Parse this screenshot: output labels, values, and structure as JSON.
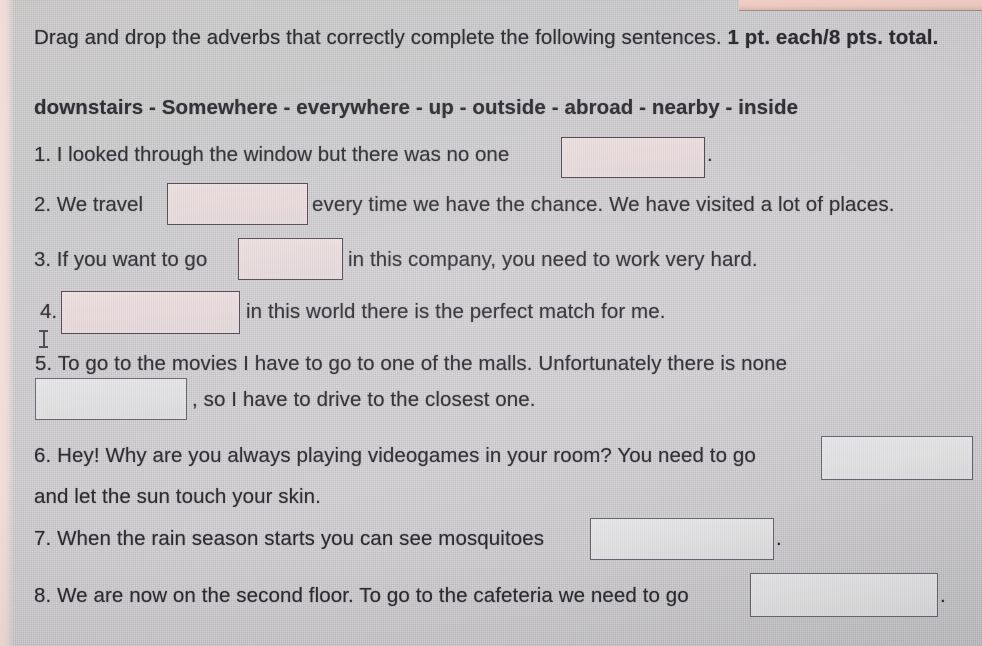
{
  "worksheet": {
    "instructions": {
      "normal_text": "Drag and drop the adverbs that correctly complete the following sentences. ",
      "bold_text": "1 pt. each/8 pts. total.",
      "full_text": "Drag and drop the adverbs that correctly complete the following sentences. 1 pt. each/8 pts. total."
    },
    "word_bank": {
      "text": "downstairs - Somewhere - everywhere - up - outside - abroad - nearby - inside",
      "words": [
        "downstairs",
        "Somewhere",
        "everywhere",
        "up",
        "outside",
        "abroad",
        "nearby",
        "inside"
      ],
      "separator": "-"
    },
    "questions": [
      {
        "number": "1.",
        "text_before": "1. I looked through the window but there was no one",
        "blank_value": "",
        "text_after": ".",
        "full_text": "1. I looked through the window but there was no one ___ ."
      },
      {
        "number": "2.",
        "text_before": "2. We travel",
        "blank_value": "",
        "text_after": "every time we have the chance. We have visited a lot of places.",
        "full_text": "2. We travel ___ every time we have the chance. We have visited a lot of places."
      },
      {
        "number": "3.",
        "text_before": "3. If you want to go",
        "blank_value": "",
        "text_after": "in this company, you need to work very hard.",
        "full_text": "3. If you want to go ___ in this company, you need to work very hard."
      },
      {
        "number": "4.",
        "text_before": "4.",
        "blank_value": "",
        "text_after": "in this world there is the perfect match for me.",
        "full_text": "4. ___ in this world there is the perfect match for me."
      },
      {
        "number": "5.",
        "text_before": "5. To go to the movies I have to go to one of the malls. Unfortunately there is none",
        "blank_value": "",
        "text_after": ", so I have to drive to the closest one.",
        "full_text": "5. To go to the movies I have to go to one of the malls. Unfortunately there is none ___ , so I have to drive to the closest one."
      },
      {
        "number": "6.",
        "text_before": "6. Hey! Why are you always playing videogames in your room? You need to go",
        "blank_value": "",
        "text_after": "and let the sun touch your skin.",
        "full_text": "6. Hey! Why are you always playing videogames in your room? You need to go ___ and let the sun touch your skin."
      },
      {
        "number": "7.",
        "text_before": "7. When the rain season starts you can see mosquitoes",
        "blank_value": "",
        "text_after": ".",
        "full_text": "7. When the rain season starts you can see mosquitoes ___ ."
      },
      {
        "number": "8.",
        "text_before": "8. We are now on the second floor. To go to the cafeteria we need to go",
        "blank_value": "",
        "text_after": ".",
        "full_text": "8. We are now on the second floor. To go to the cafeteria we need to go ___ ."
      }
    ]
  },
  "colors": {
    "page_background": "#c9c7c6",
    "text": "#2b2b30",
    "dropbox_border": "#5d5560",
    "dropbox_fill_warm": "#e7d7d9",
    "dropbox_fill_cool": "#e0e0e4",
    "left_strip": "#f3ded9",
    "top_band": "#f2cfc6"
  },
  "cursor": {
    "type": "text-cursor-ibeam"
  }
}
